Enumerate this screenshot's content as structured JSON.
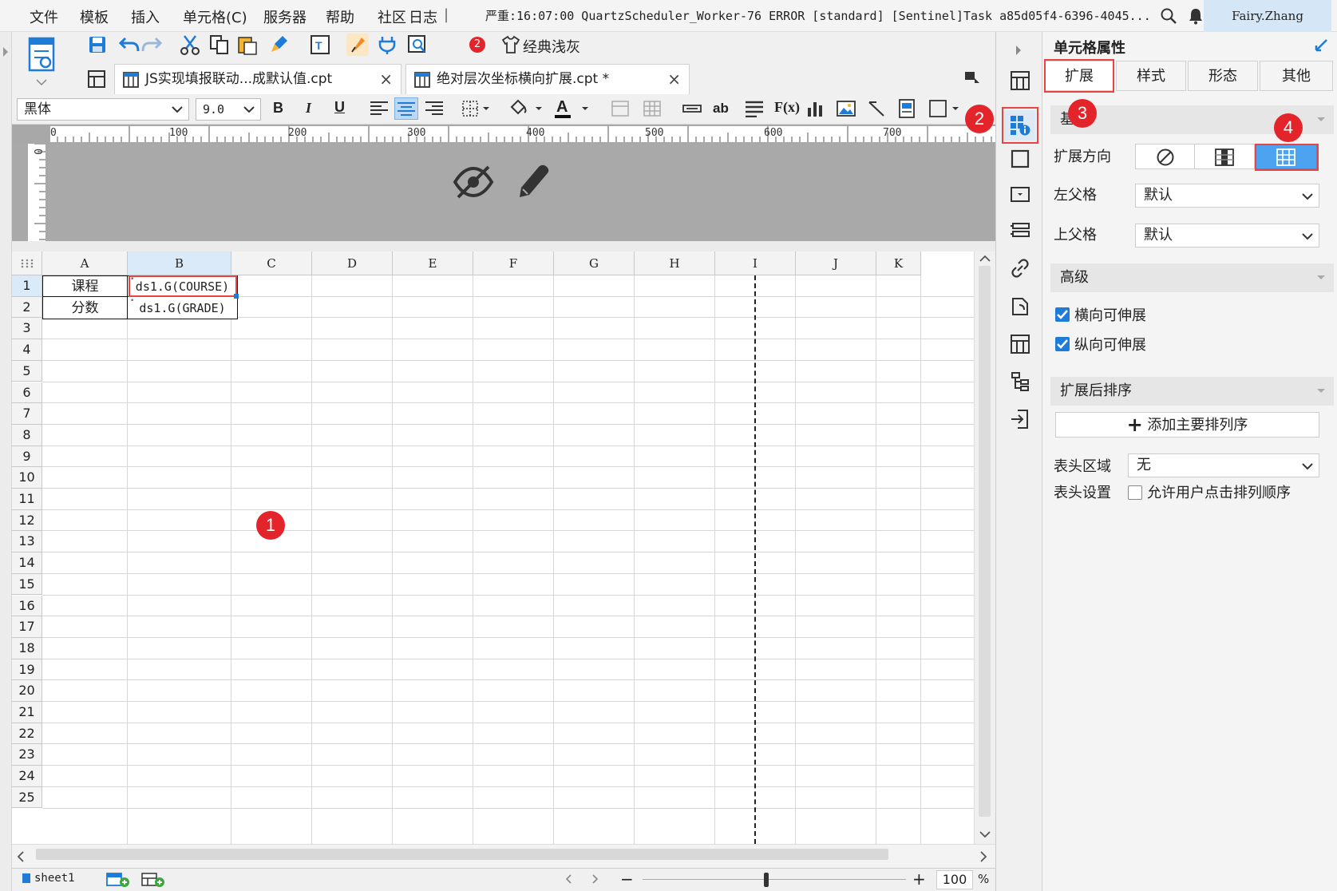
{
  "menu": {
    "items": [
      "文件",
      "模板",
      "插入",
      "单元格(C)",
      "服务器",
      "帮助",
      "社区",
      "日志"
    ],
    "log_text": "严重:16:07:00 QuartzScheduler_Worker-76 ERROR [standard] [Sentinel]Task a85d05f4-6396-4045...",
    "user": "Fairy.Zhang"
  },
  "toolbar": {
    "notification_count": "2",
    "theme_label": "经典浅灰"
  },
  "tabs": [
    {
      "label": "JS实现填报联动...成默认值.cpt"
    },
    {
      "label": "绝对层次坐标横向扩展.cpt *"
    }
  ],
  "format": {
    "font": "黑体",
    "size": "9.0",
    "bold": "B",
    "italic": "I",
    "underline": "U"
  },
  "ruler": [
    "0",
    "100",
    "200",
    "300",
    "400",
    "500",
    "600",
    "700"
  ],
  "ruler_v": "0",
  "grid": {
    "columns": [
      "A",
      "B",
      "C",
      "D",
      "E",
      "F",
      "G",
      "H",
      "I",
      "J",
      "K"
    ],
    "rows": [
      "1",
      "2",
      "3",
      "4",
      "5",
      "6",
      "7",
      "8",
      "9",
      "10",
      "11",
      "12",
      "13",
      "14",
      "15",
      "16",
      "17",
      "18",
      "19",
      "20",
      "21",
      "22",
      "23",
      "24",
      "25"
    ],
    "cells": {
      "A1": "课程",
      "B1": "ds1.G(COURSE)",
      "A2": "分数",
      "B2": "ds1.G(GRADE)"
    }
  },
  "status": {
    "sheet": "sheet1",
    "zoom": "100",
    "percent": "%"
  },
  "panel": {
    "title": "单元格属性",
    "tabs": [
      "扩展",
      "样式",
      "形态",
      "其他"
    ],
    "basic_section": "基本",
    "expand_direction_label": "扩展方向",
    "left_parent_label": "左父格",
    "left_parent_value": "默认",
    "upper_parent_label": "上父格",
    "upper_parent_value": "默认",
    "advanced_section": "高级",
    "horizontal_extendable": "横向可伸展",
    "vertical_extendable": "纵向可伸展",
    "sort_section": "扩展后排序",
    "add_sort_button": "添加主要排列序",
    "header_area_label": "表头区域",
    "header_area_value": "无",
    "header_setting_label": "表头设置",
    "header_setting_option": "允许用户点击排列顺序"
  },
  "badges": [
    "1",
    "2",
    "3",
    "4"
  ],
  "colors": {
    "accent": "#1e7bd8",
    "highlight": "#e84444",
    "badge": "#e3242b",
    "selected": "#4da3f0"
  }
}
